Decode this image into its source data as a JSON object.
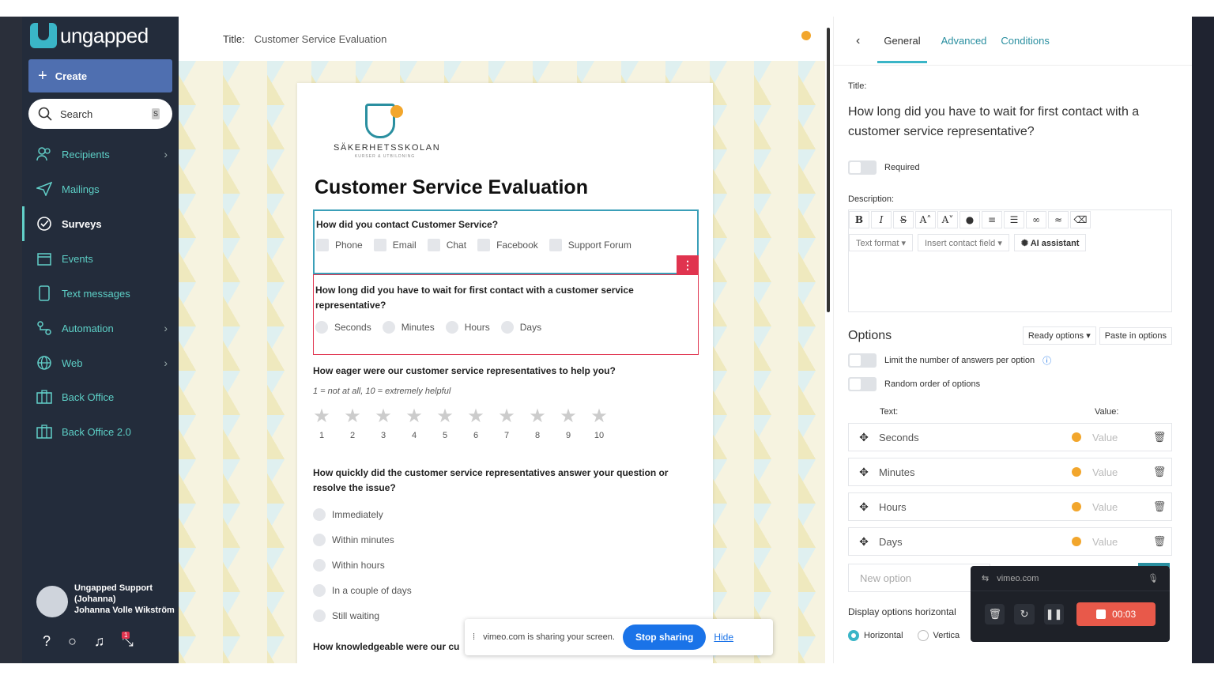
{
  "sidebar": {
    "logo_text": "ungapped",
    "create_label": "Create",
    "search_label": "Search",
    "search_shortcut": "S",
    "items": [
      {
        "label": "Recipients",
        "icon": "users-icon",
        "chevron": true
      },
      {
        "label": "Mailings",
        "icon": "send-icon",
        "chevron": false
      },
      {
        "label": "Surveys",
        "icon": "check-circle-icon",
        "chevron": false,
        "active": true
      },
      {
        "label": "Events",
        "icon": "calendar-icon",
        "chevron": false
      },
      {
        "label": "Text messages",
        "icon": "phone-icon",
        "chevron": false
      },
      {
        "label": "Automation",
        "icon": "flow-icon",
        "chevron": true
      },
      {
        "label": "Web",
        "icon": "globe-icon",
        "chevron": true
      },
      {
        "label": "Back Office",
        "icon": "briefcase-icon",
        "chevron": false
      },
      {
        "label": "Back Office 2.0",
        "icon": "briefcase-icon",
        "chevron": false
      }
    ],
    "user": {
      "line1": "Ungapped Support",
      "line2": "(Johanna)",
      "line3": "Johanna Volle Wikström"
    },
    "notification_count": "1"
  },
  "editor": {
    "title_label": "Title:",
    "title_value": "Customer Service Evaluation",
    "brand_name": "SÄKERHETSSKOLAN",
    "brand_sub": "KURSER & UTBILDNING",
    "survey_title": "Customer Service Evaluation",
    "q1": {
      "text": "How did you contact Customer Service?",
      "options": [
        "Phone",
        "Email",
        "Chat",
        "Facebook",
        "Support Forum"
      ]
    },
    "q2": {
      "text": "How long did you have to wait for first contact with a customer service representative?",
      "options": [
        "Seconds",
        "Minutes",
        "Hours",
        "Days"
      ]
    },
    "q3": {
      "text": "How eager were our customer service representatives to help you?",
      "help": "1 = not at all, 10 = extremely helpful",
      "scale": [
        "1",
        "2",
        "3",
        "4",
        "5",
        "6",
        "7",
        "8",
        "9",
        "10"
      ]
    },
    "q4": {
      "text": "How quickly did the customer service representatives answer your question or resolve the issue?",
      "options": [
        "Immediately",
        "Within minutes",
        "Within hours",
        "In a couple of days",
        "Still waiting"
      ]
    },
    "q5": {
      "text": "How knowledgeable were our cu"
    }
  },
  "sharebar": {
    "text": "vimeo.com is sharing your screen.",
    "stop": "Stop sharing",
    "hide": "Hide"
  },
  "panel": {
    "tabs": [
      "General",
      "Advanced",
      "Conditions"
    ],
    "title_label": "Title:",
    "title_value": "How long did you have to wait for first contact with a customer service representative?",
    "required_label": "Required",
    "description_label": "Description:",
    "text_format": "Text format",
    "insert_contact": "Insert contact field",
    "ai_assistant": "AI assistant",
    "options_heading": "Options",
    "ready_options": "Ready options",
    "paste_options": "Paste in options",
    "limit_label": "Limit the number of answers per option",
    "random_label": "Random order of options",
    "col_text": "Text:",
    "col_value": "Value:",
    "options": [
      {
        "text": "Seconds",
        "value_placeholder": "Value"
      },
      {
        "text": "Minutes",
        "value_placeholder": "Value"
      },
      {
        "text": "Hours",
        "value_placeholder": "Value"
      },
      {
        "text": "Days",
        "value_placeholder": "Value"
      }
    ],
    "new_option_placeholder": "New option",
    "display_label": "Display options horizontal",
    "horizontal": "Horizontal",
    "vertical": "Vertica"
  },
  "recorder": {
    "site": "vimeo.com",
    "time": "00:03"
  }
}
